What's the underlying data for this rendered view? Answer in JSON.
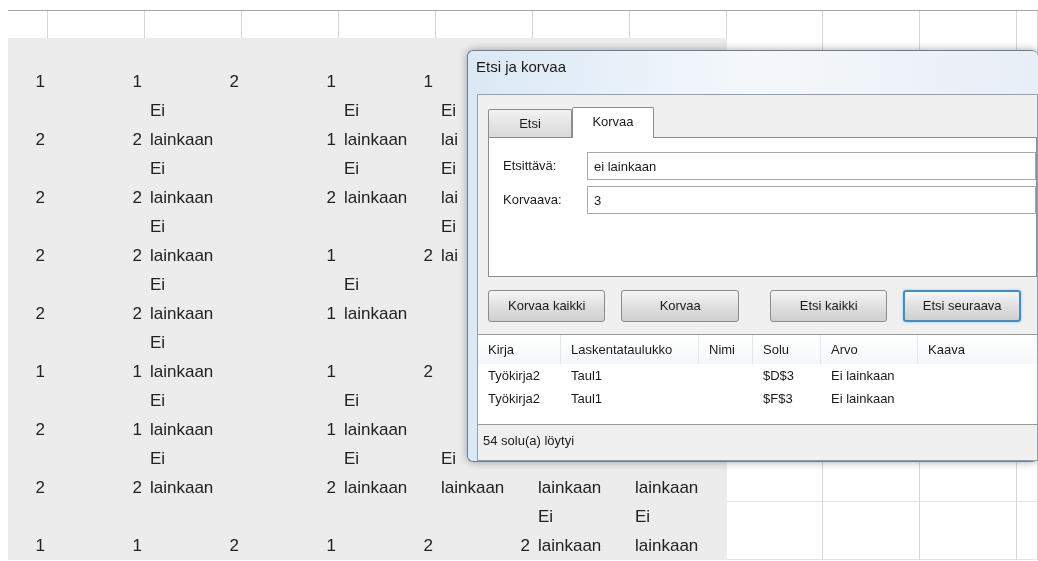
{
  "sheet": {
    "rows": [
      [
        {
          "value": "1",
          "kind": "number"
        },
        {
          "value": "1",
          "kind": "number"
        },
        {
          "value": "2",
          "kind": "number"
        },
        {
          "value": "1",
          "kind": "number"
        },
        {
          "value": "1",
          "kind": "number"
        }
      ],
      [
        {
          "value": "2",
          "kind": "number"
        },
        {
          "value": "2",
          "kind": "number"
        },
        {
          "value": "Ei lainkaan",
          "kind": "text"
        },
        {
          "value": "1",
          "kind": "number"
        },
        {
          "value": "Ei lainkaan",
          "kind": "text"
        },
        {
          "value": "Ei lai",
          "kind": "text"
        }
      ],
      [
        {
          "value": "2",
          "kind": "number"
        },
        {
          "value": "2",
          "kind": "number"
        },
        {
          "value": "Ei lainkaan",
          "kind": "text"
        },
        {
          "value": "2",
          "kind": "number"
        },
        {
          "value": "Ei lainkaan",
          "kind": "text"
        },
        {
          "value": "Ei lai",
          "kind": "text"
        }
      ],
      [
        {
          "value": "2",
          "kind": "number"
        },
        {
          "value": "2",
          "kind": "number"
        },
        {
          "value": "Ei lainkaan",
          "kind": "text"
        },
        {
          "value": "1",
          "kind": "number"
        },
        {
          "value": "2",
          "kind": "number"
        },
        {
          "value": "Ei lai",
          "kind": "text"
        }
      ],
      [
        {
          "value": "2",
          "kind": "number"
        },
        {
          "value": "2",
          "kind": "number"
        },
        {
          "value": "Ei lainkaan",
          "kind": "text"
        },
        {
          "value": "1",
          "kind": "number"
        },
        {
          "value": "Ei lainkaan",
          "kind": "text"
        }
      ],
      [
        {
          "value": "1",
          "kind": "number"
        },
        {
          "value": "1",
          "kind": "number"
        },
        {
          "value": "Ei lainkaan",
          "kind": "text"
        },
        {
          "value": "1",
          "kind": "number"
        },
        {
          "value": "2",
          "kind": "number"
        }
      ],
      [
        {
          "value": "2",
          "kind": "number"
        },
        {
          "value": "1",
          "kind": "number"
        },
        {
          "value": "Ei lainkaan",
          "kind": "text"
        },
        {
          "value": "1",
          "kind": "number"
        },
        {
          "value": "Ei lainkaan",
          "kind": "text"
        }
      ],
      [
        {
          "value": "2",
          "kind": "number"
        },
        {
          "value": "2",
          "kind": "number"
        },
        {
          "value": "Ei lainkaan",
          "kind": "text"
        },
        {
          "value": "2",
          "kind": "number"
        },
        {
          "value": "Ei lainkaan",
          "kind": "text"
        },
        {
          "value": "Ei lainkaan",
          "kind": "text"
        },
        {
          "value": "lainkaan",
          "kind": "text"
        },
        {
          "value": "lainkaan",
          "kind": "text"
        }
      ],
      [
        {
          "value": "1",
          "kind": "number"
        },
        {
          "value": "1",
          "kind": "number"
        },
        {
          "value": "2",
          "kind": "number"
        },
        {
          "value": "1",
          "kind": "number"
        },
        {
          "value": "2",
          "kind": "number"
        },
        {
          "value": "2",
          "kind": "number"
        },
        {
          "value": "Ei lainkaan",
          "kind": "text"
        },
        {
          "value": "Ei lainkaan",
          "kind": "text"
        }
      ]
    ]
  },
  "dialog": {
    "title": "Etsi ja korvaa",
    "tabs": [
      {
        "label": "Etsi",
        "selected": false
      },
      {
        "label": "Korvaa",
        "selected": true
      }
    ],
    "fields": [
      {
        "label": "Etsittävä:",
        "value": "ei lainkaan"
      },
      {
        "label": "Korvaava:",
        "value": "3"
      }
    ],
    "buttons": [
      {
        "label": "Korvaa kaikki",
        "default": false
      },
      {
        "label": "Korvaa",
        "default": false
      },
      {
        "label": "Etsi kaikki",
        "default": false
      },
      {
        "label": "Etsi seuraava",
        "default": true
      }
    ],
    "results": {
      "columns": [
        "Kirja",
        "Laskentataulukko",
        "Nimi",
        "Solu",
        "Arvo",
        "Kaava"
      ],
      "rows": [
        [
          "Työkirja2",
          "Taul1",
          null,
          "$D$3",
          "Ei lainkaan",
          null
        ],
        [
          "Työkirja2",
          "Taul1",
          null,
          "$F$3",
          "Ei lainkaan",
          null
        ]
      ]
    },
    "status_bar": "54 solu(a) löytyi"
  }
}
